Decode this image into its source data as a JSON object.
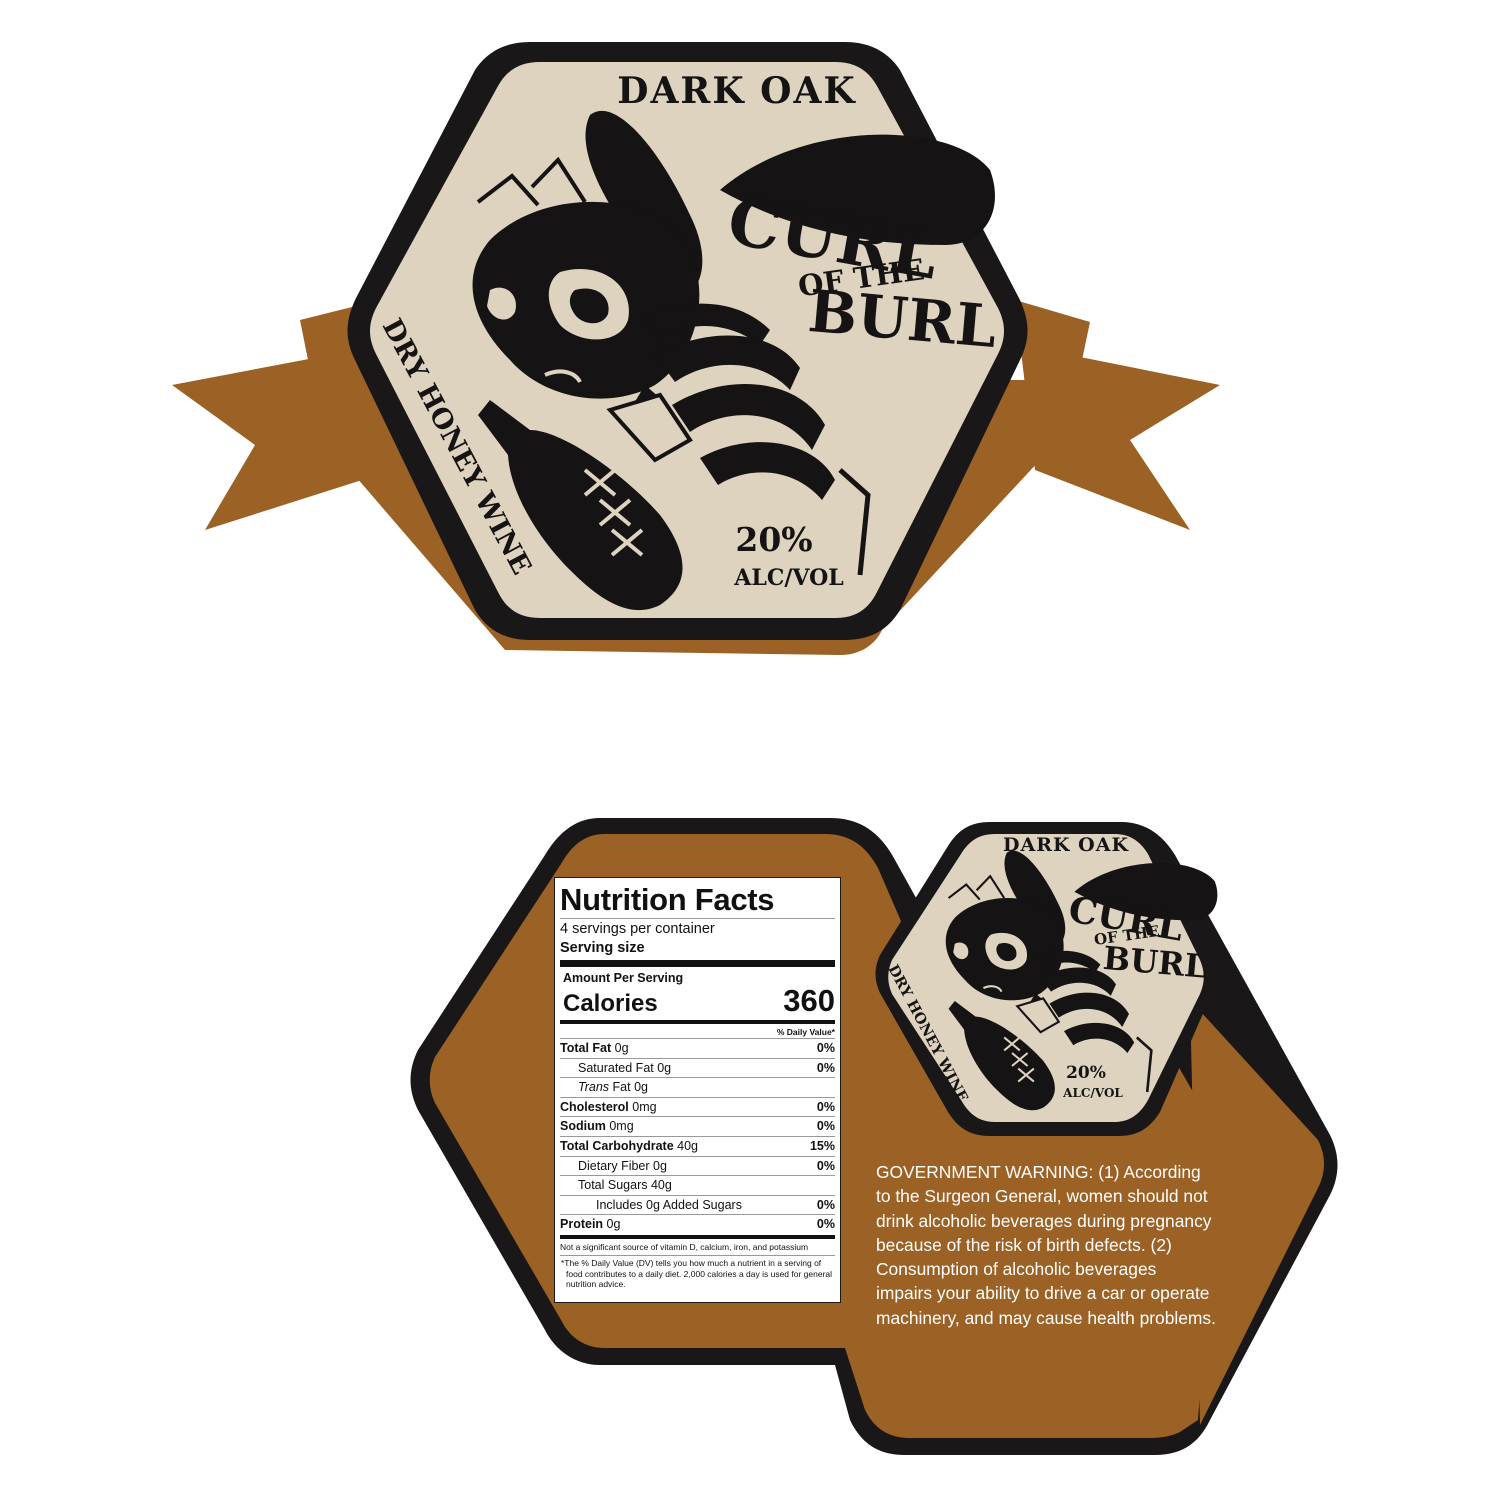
{
  "front_label": {
    "variety": "DARK OAK",
    "brand_line1": "CURL",
    "brand_line2": "OF THE",
    "brand_line3": "BURL",
    "product_type": "DRY HONEY WINE",
    "abv_value": "20%",
    "abv_unit": "ALC/VOL",
    "bottle_mark": "XXX"
  },
  "back_label": {
    "mini_label": {
      "variety": "DARK OAK",
      "brand_line1": "CURL",
      "brand_line2": "OF THE",
      "brand_line3": "BURL",
      "product_type": "DRY HONEY WINE",
      "abv_value": "20%",
      "abv_unit": "ALC/VOL"
    },
    "nutrition": {
      "title": "Nutrition Facts",
      "servings": "4 servings per container",
      "serving_size_label": "Serving size",
      "amount_per_serving": "Amount Per Serving",
      "calories_label": "Calories",
      "calories_value": "360",
      "daily_value_header": "% Daily Value*",
      "rows": [
        {
          "label": "Total Fat",
          "amount": "0g",
          "pct": "0%"
        },
        {
          "label": "Saturated Fat",
          "amount": "0g",
          "pct": "0%"
        },
        {
          "label_italic": "Trans",
          "label": "Fat",
          "amount": "0g",
          "pct": ""
        },
        {
          "label": "Cholesterol",
          "amount": "0mg",
          "pct": "0%"
        },
        {
          "label": "Sodium",
          "amount": "0mg",
          "pct": "0%"
        },
        {
          "label": "Total Carbohydrate",
          "amount": "40g",
          "pct": "15%"
        },
        {
          "label": "Dietary Fiber",
          "amount": "0g",
          "pct": "0%"
        },
        {
          "label": "Total Sugars",
          "amount": "40g",
          "pct": ""
        },
        {
          "label": "Includes 0g Added Sugars",
          "amount": "",
          "pct": "0%"
        },
        {
          "label": "Protein",
          "amount": "0g",
          "pct": "0%"
        }
      ],
      "footnote1": "Not a significant source of vitamin D, calcium, iron, and potassium",
      "footnote2": "*The % Daily Value (DV) tells you how much a nutrient in a serving of food contributes to a daily diet. 2,000 calories a day is used for general nutrition advice."
    },
    "warning": "GOVERNMENT WARNING: (1) According to the Surgeon General, women should not drink alcoholic beverages during pregnancy because of the risk of birth defects. (2) Consumption of alcoholic beverages impairs your ability to drive a car or operate machinery, and may cause health problems."
  },
  "colors": {
    "brown": "#9b6125",
    "cream": "#ddd3bf",
    "black": "#1a1718",
    "white": "#ffffff"
  }
}
